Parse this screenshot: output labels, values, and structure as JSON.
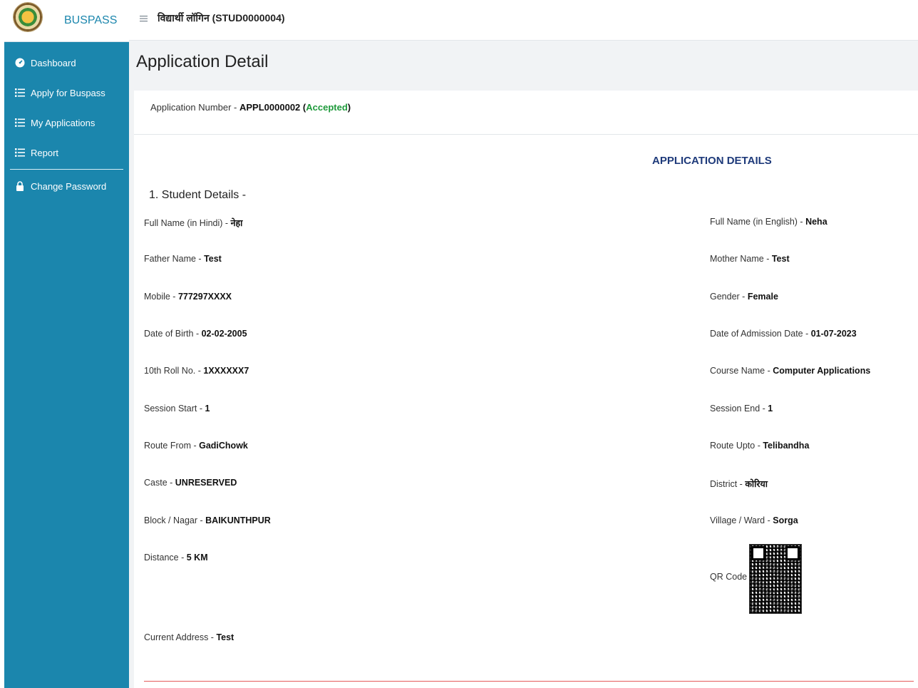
{
  "brand": {
    "name": "BUSPASS",
    "logo_icon": "government-seal-icon"
  },
  "sidebar": {
    "items": [
      {
        "label": "Dashboard",
        "icon": "dashboard-icon"
      },
      {
        "label": "Apply for Buspass",
        "icon": "list-icon"
      },
      {
        "label": "My Applications",
        "icon": "list-icon"
      },
      {
        "label": "Report",
        "icon": "list-icon"
      },
      {
        "label": "Change Password",
        "icon": "lock-icon"
      }
    ]
  },
  "topbar": {
    "title": "विद्यार्थी लॉगिन (STUD0000004)"
  },
  "page": {
    "title": "Application Detail"
  },
  "application": {
    "number_label": "Application Number - ",
    "number": "APPL0000002",
    "status_open": " (",
    "status": "Accepted",
    "status_close": ")"
  },
  "details": {
    "section_title": "APPLICATION DETAILS",
    "student_title": "1. Student Details -",
    "full_name_hindi": {
      "label": "Full Name (in Hindi) - ",
      "value": "नेहा"
    },
    "full_name_english": {
      "label": "Full Name (in English) - ",
      "value": "Neha"
    },
    "father_name": {
      "label": "Father Name - ",
      "value": "Test"
    },
    "mother_name": {
      "label": "Mother Name - ",
      "value": "Test"
    },
    "mobile": {
      "label": "Mobile - ",
      "value": "777297XXXX"
    },
    "gender": {
      "label": "Gender - ",
      "value": "Female"
    },
    "dob": {
      "label": "Date of Birth - ",
      "value": "02-02-2005"
    },
    "admission_date": {
      "label": "Date of Admission Date - ",
      "value": "01-07-2023"
    },
    "roll_no": {
      "label": "10th Roll No. - ",
      "value": "1XXXXXX7"
    },
    "course_name": {
      "label": "Course Name - ",
      "value": "Computer Applications"
    },
    "session_start": {
      "label": "Session Start - ",
      "value": "1"
    },
    "session_end": {
      "label": "Session End - ",
      "value": "1"
    },
    "route_from": {
      "label": "Route From - ",
      "value": "GadiChowk"
    },
    "route_upto": {
      "label": "Route Upto - ",
      "value": "Telibandha"
    },
    "caste": {
      "label": "Caste - ",
      "value": "UNRESERVED"
    },
    "district": {
      "label": "District - ",
      "value": "कोरिया"
    },
    "block": {
      "label": "Block / Nagar - ",
      "value": "BAIKUNTHPUR"
    },
    "village": {
      "label": "Village / Ward - ",
      "value": "Sorga"
    },
    "distance": {
      "label": "Distance - ",
      "value": "5 KM"
    },
    "qr_code": {
      "label": "QR Code - "
    },
    "current_address": {
      "label": "Current Address - ",
      "value": "Test"
    }
  },
  "colors": {
    "sidebar_bg": "#1b86ad",
    "accepted": "#1e9a3b",
    "section_title": "#1e3a7a",
    "divider": "#e45b5b"
  }
}
